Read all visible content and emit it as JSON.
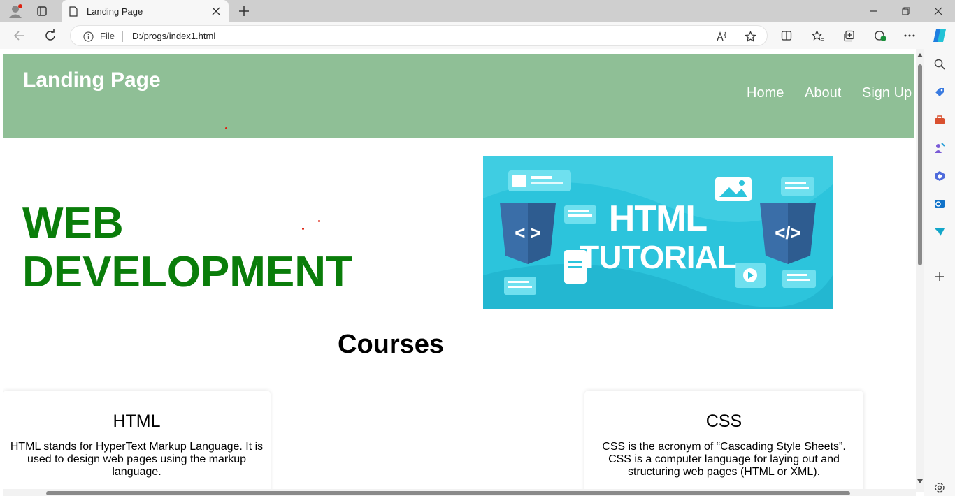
{
  "browser": {
    "tab_title": "Landing Page",
    "address_scheme": "File",
    "address_url": "D:/progs/index1.html"
  },
  "page": {
    "logo": "Landing Page",
    "nav": [
      "Home",
      "About",
      "Sign Up"
    ],
    "hero_line1": "WEB",
    "hero_line2": "DEVELOPMENT",
    "banner": {
      "line1": "HTML",
      "line2": "TUTORIAL",
      "left_code": "< >",
      "right_code": "</>"
    },
    "courses_heading": "Courses",
    "cards": [
      {
        "title": "HTML",
        "desc": "HTML stands for HyperText Markup Language. It is used to design web pages using the markup language."
      },
      {
        "title": "CSS",
        "desc": "CSS is the acronym of “Cascading Style Sheets”. CSS is a computer language for laying out and structuring web pages (HTML or XML)."
      }
    ]
  },
  "colors": {
    "header": "#8fbf96",
    "hero": "#0a7d0a",
    "banner": "#2cc4dc"
  },
  "icons": [
    "profile-icon",
    "tab-actions-icon",
    "page-icon",
    "close-icon",
    "new-tab-icon",
    "minimize-icon",
    "restore-icon",
    "window-close-icon",
    "back-icon",
    "refresh-icon",
    "info-icon",
    "read-aloud-icon",
    "favorite-icon",
    "split-screen-icon",
    "favorites-icon",
    "collections-icon",
    "extensions-icon",
    "more-icon",
    "copilot-icon",
    "search-icon",
    "shopping-icon",
    "tools-icon",
    "games-icon",
    "office-icon",
    "outlook-icon",
    "send-icon",
    "add-icon",
    "settings-icon"
  ]
}
